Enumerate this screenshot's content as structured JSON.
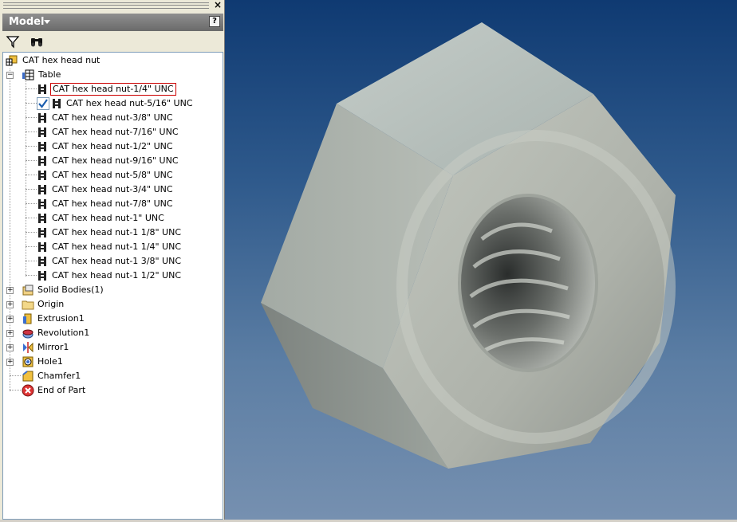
{
  "browser": {
    "close_label": "×",
    "title": "Model",
    "help_label": "?",
    "toolbar": {
      "filter_icon": "filter-icon",
      "find_icon": "binoculars-icon"
    },
    "tree": {
      "root": "CAT hex head nut",
      "table_label": "Table",
      "members": [
        "CAT hex head nut-1/4\" UNC",
        "CAT hex head nut-5/16\" UNC",
        "CAT hex head nut-3/8\" UNC",
        "CAT hex head nut-7/16\" UNC",
        "CAT hex head nut-1/2\" UNC",
        "CAT hex head nut-9/16\" UNC",
        "CAT hex head nut-5/8\" UNC",
        "CAT hex head nut-3/4\" UNC",
        "CAT hex head nut-7/8\" UNC",
        "CAT hex head nut-1\" UNC",
        "CAT hex head nut-1 1/8\" UNC",
        "CAT hex head nut-1 1/4\" UNC",
        "CAT hex head nut-1 3/8\" UNC",
        "CAT hex head nut-1 1/2\" UNC"
      ],
      "active_member_index": 1,
      "selected_member_index": 0,
      "features": [
        {
          "label": "Solid Bodies(1)",
          "icon": "solid-bodies-icon",
          "expandable": true
        },
        {
          "label": "Origin",
          "icon": "folder-icon",
          "expandable": true
        },
        {
          "label": "Extrusion1",
          "icon": "extrusion-icon",
          "expandable": true
        },
        {
          "label": "Revolution1",
          "icon": "revolution-icon",
          "expandable": true
        },
        {
          "label": "Mirror1",
          "icon": "mirror-icon",
          "expandable": true
        },
        {
          "label": "Hole1",
          "icon": "hole-icon",
          "expandable": true
        },
        {
          "label": "Chamfer1",
          "icon": "chamfer-icon",
          "expandable": false
        },
        {
          "label": "End of Part",
          "icon": "end-of-part-icon",
          "expandable": false
        }
      ]
    }
  },
  "viewport": {
    "object": "hex-nut-3d-model"
  }
}
